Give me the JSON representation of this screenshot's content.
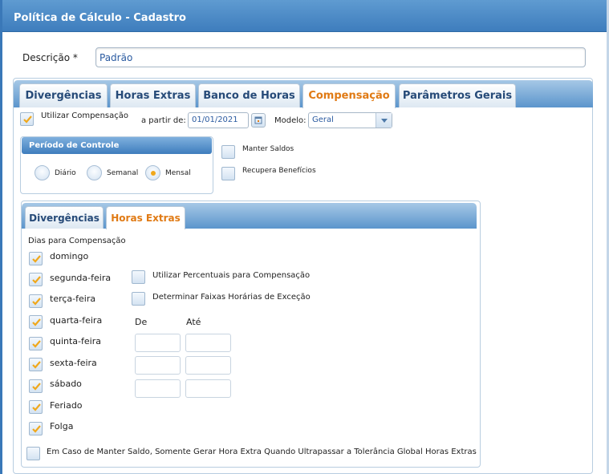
{
  "window": {
    "title": "Política de Cálculo - Cadastro"
  },
  "descricao": {
    "label": "Descrição  *",
    "value": "Padrão"
  },
  "tabs": [
    {
      "label": "Divergências"
    },
    {
      "label": "Horas Extras"
    },
    {
      "label": "Banco de Horas"
    },
    {
      "label": "Compensação"
    },
    {
      "label": "Parâmetros Gerais"
    }
  ],
  "compensacao": {
    "utilizar_label": "Utilizar Compensação",
    "utilizar_checked": true,
    "a_partir_label": "a partir de:",
    "date_value": "01/01/2021",
    "modelo_label": "Modelo:",
    "modelo_value": "Geral",
    "periodo": {
      "title": "Período de Controle",
      "options": [
        "Diário",
        "Semanal",
        "Mensal"
      ],
      "selected": "Mensal"
    },
    "manter_saldos_label": "Manter Saldos",
    "recupera_beneficios_label": "Recupera Benefícios",
    "inner_tabs": [
      {
        "label": "Divergências"
      },
      {
        "label": "Horas Extras"
      }
    ],
    "dias_label": "Dias para Compensação",
    "dias": [
      {
        "label": "domingo",
        "checked": true
      },
      {
        "label": "segunda-feira",
        "checked": true
      },
      {
        "label": "terça-feira",
        "checked": true
      },
      {
        "label": "quarta-feira",
        "checked": true
      },
      {
        "label": "quinta-feira",
        "checked": true
      },
      {
        "label": "sexta-feira",
        "checked": true
      },
      {
        "label": "sábado",
        "checked": true
      },
      {
        "label": "Feriado",
        "checked": true
      },
      {
        "label": "Folga",
        "checked": true
      }
    ],
    "utilizar_percentuais_label": "Utilizar Percentuais para Compensação",
    "determinar_faixas_label": "Determinar Faixas Horárias de Exceção",
    "de_label": "De",
    "ate_label": "Até",
    "manter_saldo_extra_label": "Em Caso de Manter Saldo, Somente Gerar Hora Extra Quando Ultrapassar a Tolerância Global Horas Extras"
  },
  "colors": {
    "accent": "#e07a14",
    "header": "#3e7dbd",
    "check": "#f0a81c"
  }
}
